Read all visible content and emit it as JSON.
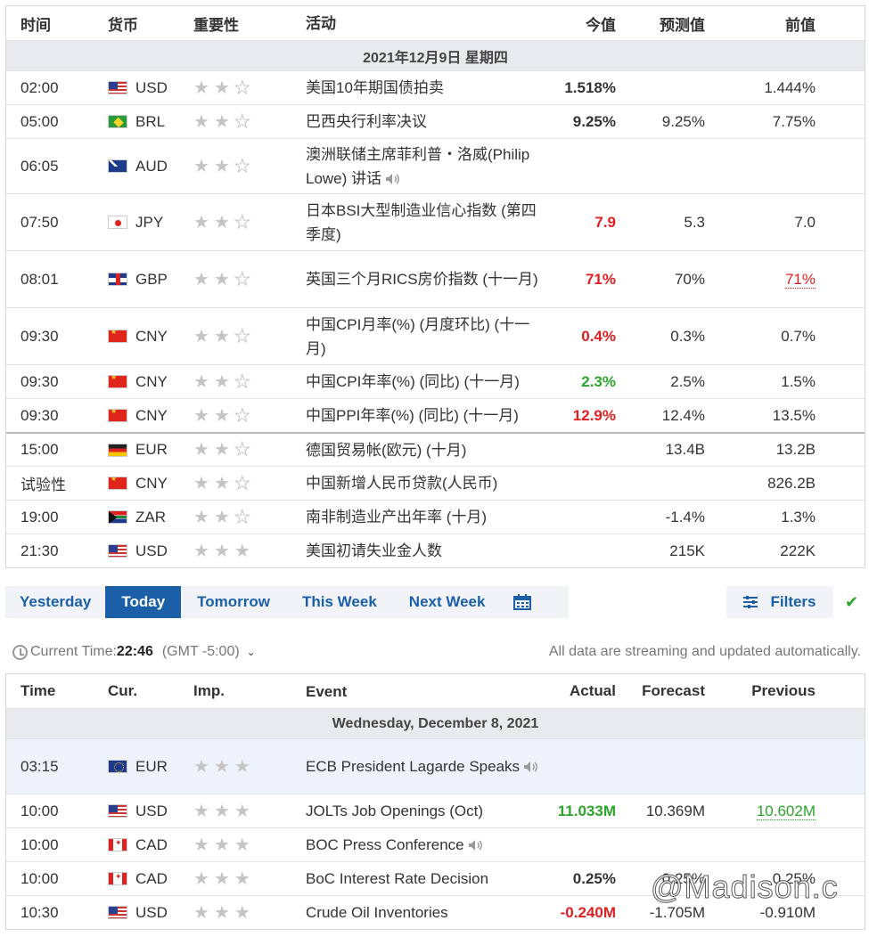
{
  "cn_table": {
    "headers": {
      "time": "时间",
      "cur": "货币",
      "imp": "重要性",
      "event": "活动",
      "actual": "今值",
      "forecast": "预测值",
      "previous": "前值"
    },
    "date_label": "2021年12月9日  星期四",
    "rows": [
      {
        "time": "02:00",
        "cur": "USD",
        "flag": "us",
        "stars": 2,
        "event": "美国10年期国债拍卖",
        "actual": "1.518%",
        "actual_color": "black",
        "forecast": "",
        "previous": "1.444%"
      },
      {
        "time": "05:00",
        "cur": "BRL",
        "flag": "br",
        "stars": 2,
        "event": "巴西央行利率决议",
        "actual": "9.25%",
        "actual_color": "black",
        "forecast": "9.25%",
        "previous": "7.75%"
      },
      {
        "time": "06:05",
        "cur": "AUD",
        "flag": "au",
        "stars": 2,
        "event": "澳洲联储主席菲利普・洛威(Philip Lowe) 讲话",
        "speaker": true,
        "actual": "",
        "forecast": "",
        "previous": ""
      },
      {
        "time": "07:50",
        "cur": "JPY",
        "flag": "jp",
        "stars": 2,
        "event": "日本BSI大型制造业信心指数 (第四季度)",
        "actual": "7.9",
        "actual_color": "red",
        "forecast": "5.3",
        "previous": "7.0"
      },
      {
        "time": "08:01",
        "cur": "GBP",
        "flag": "gb",
        "stars": 2,
        "event": "英国三个月RICS房价指数 (十一月)",
        "actual": "71%",
        "actual_color": "red",
        "forecast": "70%",
        "previous": "71%",
        "previous_color": "red"
      },
      {
        "time": "09:30",
        "cur": "CNY",
        "flag": "cn",
        "stars": 2,
        "event": "中国CPI月率(%) (月度环比) (十一月)",
        "actual": "0.4%",
        "actual_color": "red",
        "forecast": "0.3%",
        "previous": "0.7%"
      },
      {
        "time": "09:30",
        "cur": "CNY",
        "flag": "cn",
        "stars": 2,
        "event": "中国CPI年率(%) (同比) (十一月)",
        "actual": "2.3%",
        "actual_color": "green",
        "forecast": "2.5%",
        "previous": "1.5%"
      },
      {
        "time": "09:30",
        "cur": "CNY",
        "flag": "cn",
        "stars": 2,
        "event": "中国PPI年率(%) (同比) (十一月)",
        "actual": "12.9%",
        "actual_color": "red",
        "forecast": "12.4%",
        "previous": "13.5%"
      },
      {
        "time": "15:00",
        "cur": "EUR",
        "flag": "de",
        "stars": 2,
        "event": "德国贸易帐(欧元) (十月)",
        "actual": "",
        "forecast": "13.4B",
        "previous": "13.2B"
      },
      {
        "time": "试验性",
        "cur": "CNY",
        "flag": "cn",
        "stars": 2,
        "event": "中国新增人民币贷款(人民币)",
        "actual": "",
        "forecast": "",
        "previous": "826.2B"
      },
      {
        "time": "19:00",
        "cur": "ZAR",
        "flag": "za",
        "stars": 2,
        "event": "南非制造业产出年率 (十月)",
        "actual": "",
        "forecast": "-1.4%",
        "previous": "1.3%"
      },
      {
        "time": "21:30",
        "cur": "USD",
        "flag": "us",
        "stars": 3,
        "event": "美国初请失业金人数",
        "actual": "",
        "forecast": "215K",
        "previous": "222K"
      }
    ]
  },
  "nav": {
    "tabs": [
      "Yesterday",
      "Today",
      "Tomorrow",
      "This Week",
      "Next Week"
    ],
    "active": "Today",
    "filters": "Filters"
  },
  "timebar": {
    "label": "Current Time:",
    "time": "22:46",
    "tz": "(GMT -5:00)",
    "auto": "All data are streaming and updated automatically."
  },
  "en_table": {
    "headers": {
      "time": "Time",
      "cur": "Cur.",
      "imp": "Imp.",
      "event": "Event",
      "actual": "Actual",
      "forecast": "Forecast",
      "previous": "Previous"
    },
    "date_label": "Wednesday, December 8, 2021",
    "rows": [
      {
        "time": "03:15",
        "cur": "EUR",
        "flag": "eu",
        "stars": 3,
        "event": "ECB President Lagarde Speaks",
        "speaker": true,
        "actual": "",
        "forecast": "",
        "previous": ""
      },
      {
        "time": "10:00",
        "cur": "USD",
        "flag": "us",
        "stars": 3,
        "event": "JOLTs Job Openings (Oct)",
        "actual": "11.033M",
        "actual_color": "green",
        "forecast": "10.369M",
        "previous": "10.602M",
        "previous_color": "green"
      },
      {
        "time": "10:00",
        "cur": "CAD",
        "flag": "ca",
        "stars": 3,
        "event": "BOC Press Conference",
        "speaker": true,
        "actual": "",
        "forecast": "",
        "previous": ""
      },
      {
        "time": "10:00",
        "cur": "CAD",
        "flag": "ca",
        "stars": 3,
        "event": "BoC Interest Rate Decision",
        "actual": "0.25%",
        "actual_color": "black",
        "forecast": "0.25%",
        "previous": "0.25%"
      },
      {
        "time": "10:30",
        "cur": "USD",
        "flag": "us",
        "stars": 3,
        "event": "Crude Oil Inventories",
        "actual": "-0.240M",
        "actual_color": "red",
        "forecast": "-1.705M",
        "previous": "-0.910M"
      }
    ]
  },
  "watermark": "@Madison.c"
}
